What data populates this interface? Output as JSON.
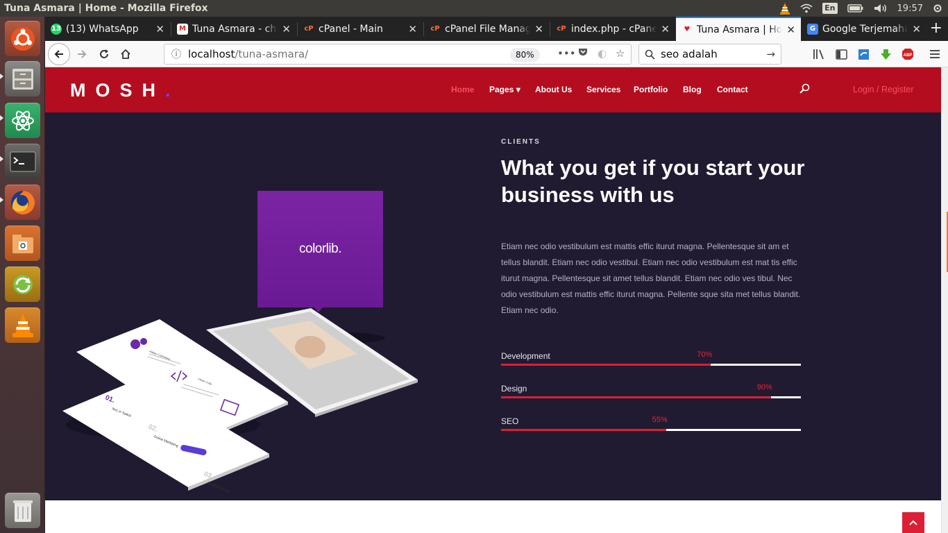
{
  "os": {
    "window_title": "Tuna Asmara | Home - Mozilla Firefox",
    "keyboard": "En",
    "clock": "19:57"
  },
  "launcher": {
    "items": [
      {
        "name": "ubuntu-dash"
      },
      {
        "name": "file-manager"
      },
      {
        "name": "atom-editor"
      },
      {
        "name": "terminal"
      },
      {
        "name": "firefox"
      },
      {
        "name": "files"
      },
      {
        "name": "software-updater"
      },
      {
        "name": "vlc"
      },
      {
        "name": "trash"
      }
    ]
  },
  "browser": {
    "tabs": [
      {
        "label": "(13) WhatsApp",
        "badge": "13"
      },
      {
        "label": "Tuna Asmara - cha",
        "badge": "M"
      },
      {
        "label": "cPanel - Main",
        "badge": "cP"
      },
      {
        "label": "cPanel File Manag",
        "badge": "cP"
      },
      {
        "label": "index.php - cPane",
        "badge": "cP"
      },
      {
        "label": "Tuna Asmara | Ho",
        "badge": "♥"
      },
      {
        "label": "Google Terjemaha",
        "badge": "G"
      }
    ],
    "url_host": "localhost",
    "url_path": "/tuna-asmara/",
    "zoom": "80%",
    "search_value": "seo adalah",
    "abp": "ABP"
  },
  "site": {
    "logo_text": "MOSH",
    "logo_dot": ".",
    "menu": {
      "home": "Home",
      "pages": "Pages ▾",
      "about": "About Us",
      "services": "Services",
      "portfolio": "Portfolio",
      "blog": "Blog",
      "contact": "Contact",
      "login": "Login / Register"
    },
    "section": {
      "eyebrow": "CLIENTS",
      "headline": "What you get if you start your business with us",
      "body": "Etiam nec odio vestibulum est mattis effic iturut magna. Pellentesque sit am et tellus blandit. Etiam nec odio vestibul. Etiam nec odio vestibulum est mat tis effic iturut magna. Pellentesque sit amet tellus blandit. Etiam nec odio ves tibul. Nec odio vestibulum est mattis effic iturut magna. Pellente sque sita met tellus blandit. Etiam nec odio.",
      "mockup_brand": "colorlib."
    },
    "skills": [
      {
        "label": "Development",
        "pct_text": "70%",
        "value": 0.7
      },
      {
        "label": "Design",
        "pct_text": "90%",
        "value": 0.9
      },
      {
        "label": "SEO",
        "pct_text": "55%",
        "value": 0.55
      }
    ],
    "mockup_text": {
      "step1": "01.",
      "step1_title": "No1 in Sales!",
      "step2": "02.",
      "step2_title": "Online Marketing",
      "step3": "03.",
      "step3_title": "Modern Design",
      "page_heading": "Happy Customers",
      "section2": "Clean Code"
    }
  },
  "colors": {
    "header_red": "#b50d20",
    "section_dark": "#201b31",
    "accent_red": "#dc1f35",
    "brand_purple": "#7b24a4"
  }
}
